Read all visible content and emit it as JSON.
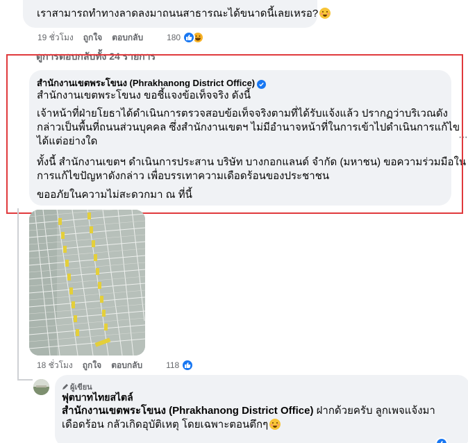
{
  "top_comment": {
    "text": "เราสามารถทำทางลาดลงมาถนนสาธารณะได้ขนาดนี้เลยเหรอ?",
    "time": "19 ชั่วโมง",
    "like": "ถูกใจ",
    "reply": "ตอบกลับ",
    "reaction_count": "180",
    "reactions": [
      "like-icon",
      "haha-icon"
    ]
  },
  "replies_header": "ดูการตอบกลับทั้ง 24 รายการ",
  "office_reply": {
    "name": "สำนักงานเขตพระโขนง (Phrakhanong District Office)",
    "verified": true,
    "paragraphs": [
      [
        "สำนักงานเขตพระโขนง ขอชี้แจงข้อเท็จจริง ดังนี้"
      ],
      [
        "เจ้าหน้าที่ฝ่ายโยธาได้ดำเนินการตรวจสอบข้อเท็จจริงตามที่ได้รับแจ้งแล้ว ปรากฏว่าบริเวณดัง",
        "กล่าวเป็นพื้นที่ถนนส่วนบุคคล ซึ่งสำนักงานเขตฯ ไม่มีอำนาจหน้าที่ในการเข้าไปดำเนินการแก้ไข",
        "ได้แต่อย่างใด"
      ],
      [
        "ทั้งนี้ สำนักงานเขตฯ ดำเนินการประสาน บริษัท บางกอกแลนด์ จำกัด (มหาชน) ขอความร่วมมือใน",
        "การแก้ไขปัญหาดังกล่าว เพื่อบรรเทาความเดือดร้อนของประชาชน"
      ],
      [
        "ขออภัยในความไม่สะดวกมา ณ ที่นี้"
      ]
    ],
    "time": "18 ชั่วโมง",
    "like": "ถูกใจ",
    "reply": "ตอบกลับ",
    "reaction_count": "118",
    "reactions": [
      "like-icon"
    ]
  },
  "author_reply": {
    "badge": "ผู้เขียน",
    "name": "ฟุตบาทไทยสไตล์",
    "mention": "สำนักงานเขตพระโขนง (Phrakhanong District Office)",
    "text_after_mention": " ฝากด้วยครับ ลูกเพจแจ้งมา",
    "line2": "เดือดร้อน กลัวเกิดอุบัติเหตุ โดยเฉพาะตอนตึกๆ"
  },
  "colors": {
    "bubble": "#f0f2f5",
    "meta": "#65676b",
    "like_blue": "#1877f2",
    "frame_red": "#e0393c"
  }
}
